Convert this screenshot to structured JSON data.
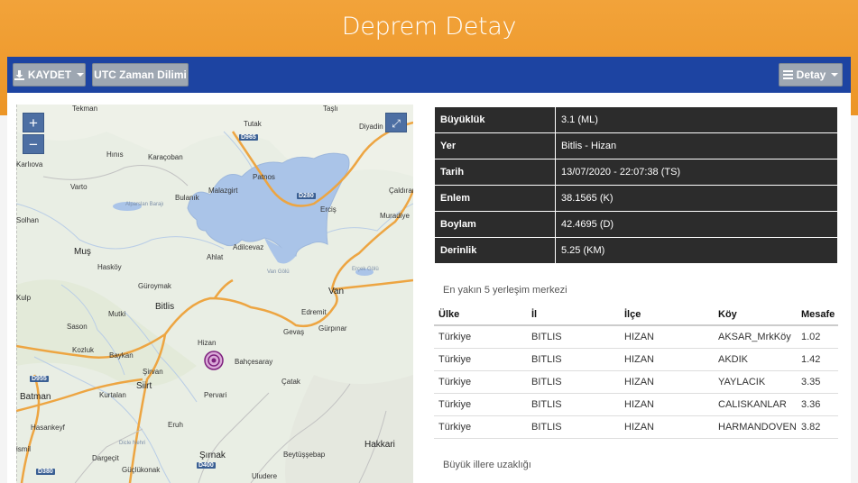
{
  "header": {
    "title": "Deprem Detay"
  },
  "toolbar": {
    "save_label": "KAYDET",
    "utc_label": "UTC Zaman Dilimi",
    "detail_label": "Detay"
  },
  "map": {
    "zoom_in": "+",
    "zoom_out": "−",
    "expand": "⤢",
    "labels": {
      "tekman": "Tekman",
      "hinis": "Hınıs",
      "karacoban": "Karaçoban",
      "tutak": "Tutak",
      "tasli": "Taşlı",
      "diyadin": "Diyadin",
      "karliova": "Karlıova",
      "varto": "Varto",
      "bulanik": "Bulanık",
      "malazgirt": "Malazgirt",
      "patnos": "Patnos",
      "caldiran": "Çaldıran",
      "solhan": "Solhan",
      "ercis": "Erciş",
      "muradiye": "Muradiye",
      "adilcevaz": "Adilcevaz",
      "ahlat": "Ahlat",
      "mus": "Muş",
      "haskoy": "Hasköy",
      "guroymak": "Güroymak",
      "kulp": "Kulp",
      "bitlis": "Bitlis",
      "mutki": "Mutki",
      "van": "Van",
      "edremit": "Edremit",
      "sason": "Sason",
      "gevas": "Gevaş",
      "gurpinar": "Gürpınar",
      "hizan": "Hizan",
      "kozluk": "Kozluk",
      "baykan": "Baykan",
      "bahcesaray": "Bahçesaray",
      "sirvan": "Şirvan",
      "siirt": "Siirt",
      "kurtalan": "Kurtalan",
      "pervari": "Pervari",
      "catak": "Çatak",
      "batman": "Batman",
      "eruh": "Eruh",
      "hasankeyf": "Hasankeyf",
      "sirnak": "Şırnak",
      "beytussebap": "Beytüşşebap",
      "hakkari": "Hakkari",
      "dargecit": "Dargeçit",
      "guclukonak": "Güçlükonak",
      "uludere": "Uludere",
      "bismil": "ismil",
      "lake_van": "Van Gölü",
      "ercek": "Erçek Gölü",
      "aparslan": "Alparslan Barajı",
      "dicle": "Dicle Nehri",
      "r_d965": "D965",
      "r_d280": "D280",
      "r_d955": "D955",
      "r_d400": "D400",
      "r_d380": "D380"
    }
  },
  "details": [
    {
      "key": "Büyüklük",
      "value": "3.1 (ML)"
    },
    {
      "key": "Yer",
      "value": "Bitlis - Hizan"
    },
    {
      "key": "Tarih",
      "value": "13/07/2020 - 22:07:38 (TS)"
    },
    {
      "key": "Enlem",
      "value": "38.1565 (K)"
    },
    {
      "key": "Boylam",
      "value": "42.4695 (D)"
    },
    {
      "key": "Derinlik",
      "value": "5.25 (KM)"
    }
  ],
  "nearest": {
    "title": "En yakın 5 yerleşim merkezi",
    "columns": [
      "Ülke",
      "İl",
      "İlçe",
      "Köy",
      "Mesafe"
    ],
    "rows": [
      [
        "Türkiye",
        "BITLIS",
        "HIZAN",
        "AKSAR_MrkKöy",
        "1.02"
      ],
      [
        "Türkiye",
        "BITLIS",
        "HIZAN",
        "AKDIK",
        "1.42"
      ],
      [
        "Türkiye",
        "BITLIS",
        "HIZAN",
        "YAYLACIK",
        "3.35"
      ],
      [
        "Türkiye",
        "BITLIS",
        "HIZAN",
        "CALISKANLAR",
        "3.36"
      ],
      [
        "Türkiye",
        "BITLIS",
        "HIZAN",
        "HARMANDOVEN",
        "3.82"
      ]
    ]
  },
  "cities_title": "Büyük illere uzaklığı",
  "colors": {
    "header": "#ec9526",
    "toolbar": "#1d44a2",
    "table": "#2c2c2c",
    "lake": "#aac4e8"
  }
}
